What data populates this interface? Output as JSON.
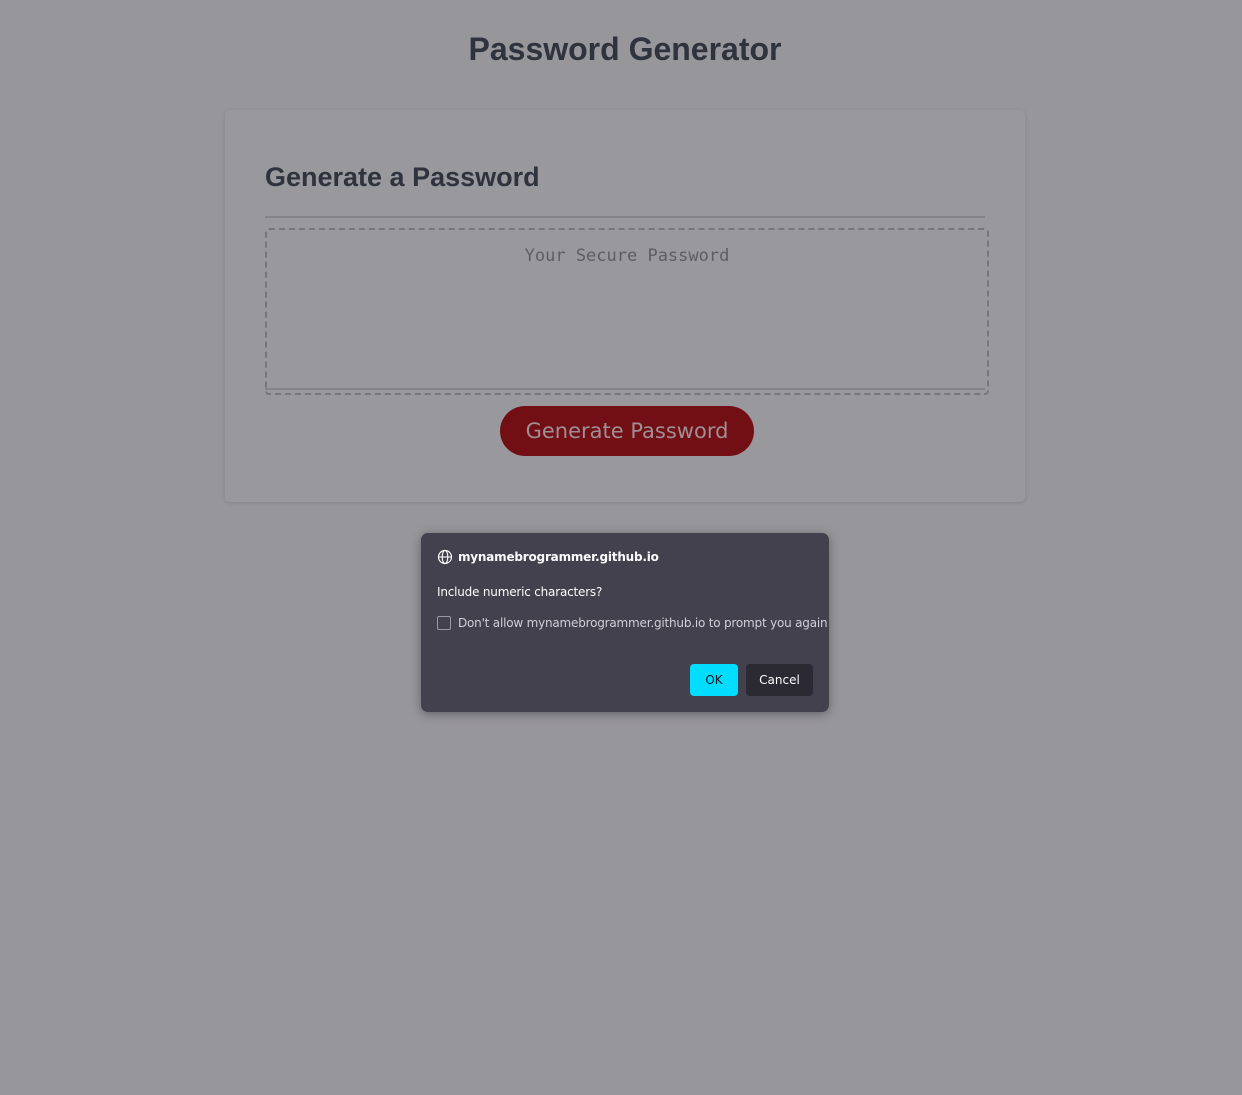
{
  "page": {
    "title": "Password Generator"
  },
  "card": {
    "header": "Generate a Password",
    "password_placeholder": "Your Secure Password",
    "password_value": "",
    "generate_button_label": "Generate Password"
  },
  "dialog": {
    "origin": "mynamebrogrammer.github.io",
    "origin_icon": "globe-icon",
    "message": "Include numeric characters?",
    "checkbox_label": "Don't allow mynamebrogrammer.github.io to prompt you again",
    "checkbox_checked": false,
    "ok_label": "OK",
    "cancel_label": "Cancel"
  },
  "colors": {
    "overlay_background": "#97969b",
    "generate_button": "#720f15",
    "dialog_background": "#42414d",
    "ok_button": "#00ddff",
    "cancel_button": "#2b2a33"
  }
}
